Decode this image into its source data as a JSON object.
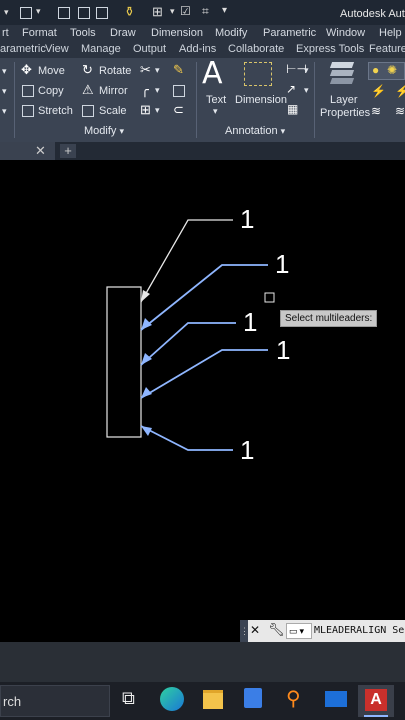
{
  "app": {
    "title": "Autodesk Auto"
  },
  "menu": [
    "rt",
    "Format",
    "Tools",
    "Draw",
    "Dimension",
    "Modify",
    "Parametric",
    "Window",
    "Help"
  ],
  "ribbon_tabs": [
    "arametric",
    "View",
    "Manage",
    "Output",
    "Add-ins",
    "Collaborate",
    "Express Tools",
    "Featured"
  ],
  "modify_panel": {
    "title": "Modify",
    "items": [
      "Move",
      "Rotate",
      "Copy",
      "Mirror",
      "Stretch",
      "Scale"
    ]
  },
  "annotation_panel": {
    "title": "Annotation",
    "text_label": "Text",
    "dimension_label": "Dimension"
  },
  "layers_panel": {
    "label_line1": "Layer",
    "label_line2": "Properties"
  },
  "drawing": {
    "leader_numbers": [
      "1",
      "1",
      "1",
      "1",
      "1"
    ]
  },
  "tooltip": "Select multileaders:",
  "command": {
    "text": "MLEADERALIGN Sel"
  },
  "taskbar": {
    "search_text": "rch"
  }
}
